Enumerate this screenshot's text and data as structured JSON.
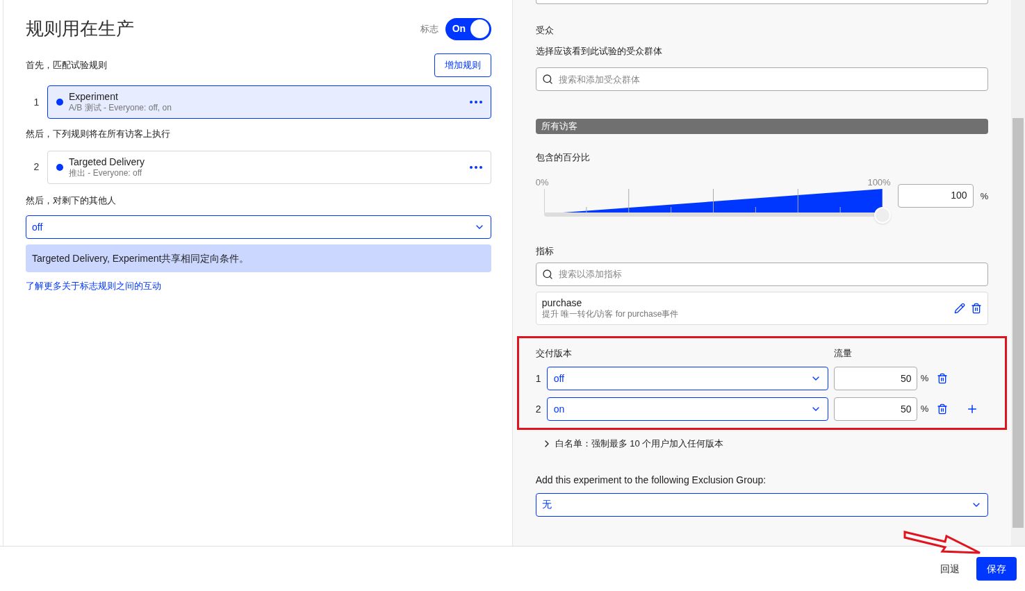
{
  "left": {
    "title": "规则用在生产",
    "flag": {
      "label": "标志",
      "toggle_label": "On",
      "on": true
    },
    "add_rule_button": "增加规则",
    "rule_groups": [
      {
        "heading": "首先，匹配试验规则",
        "rules": [
          {
            "index": "1",
            "name": "Experiment",
            "detail": "A/B 测试 - Everyone: off, on",
            "selected": true
          }
        ]
      },
      {
        "heading": "然后，下列规则将在所有访客上执行",
        "rules": [
          {
            "index": "2",
            "name": "Targeted Delivery",
            "detail": "推出 - Everyone: off",
            "selected": false
          }
        ]
      }
    ],
    "rest_heading": "然后，对剩下的其他人",
    "rest_select": "off",
    "notice": "Targeted Delivery, Experiment共享相同定向条件。",
    "learn_more_link": "了解更多关于标志规则之间的互动"
  },
  "right": {
    "audience": {
      "title": "受众",
      "subtitle": "选择应该看到此试验的受众群体",
      "search_placeholder": "搜索和添加受众群体",
      "bar": "所有访客"
    },
    "traffic": {
      "label": "包含的百分比",
      "min_label": "0%",
      "max_label": "100%",
      "level": 1.0,
      "value": "100",
      "unit": "%"
    },
    "metrics": {
      "title": "指标",
      "search_placeholder": "搜索以添加指标",
      "items": [
        {
          "name": "purchase",
          "detail": "提升 唯一转化/访客 for purchase事件"
        }
      ]
    },
    "variations": {
      "col_version": "交付版本",
      "col_traffic": "流量",
      "rows": [
        {
          "index": "1",
          "value": "off",
          "traffic": "50",
          "unit": "%"
        },
        {
          "index": "2",
          "value": "on",
          "traffic": "50",
          "unit": "%"
        }
      ]
    },
    "whitelist": {
      "label": "白名单：强制最多 10 个用户加入任何版本",
      "expanded": false
    },
    "exclusion": {
      "label": "Add this experiment to the following Exclusion Group:",
      "value": "无"
    }
  },
  "footer": {
    "revert": "回退",
    "save": "保存"
  }
}
